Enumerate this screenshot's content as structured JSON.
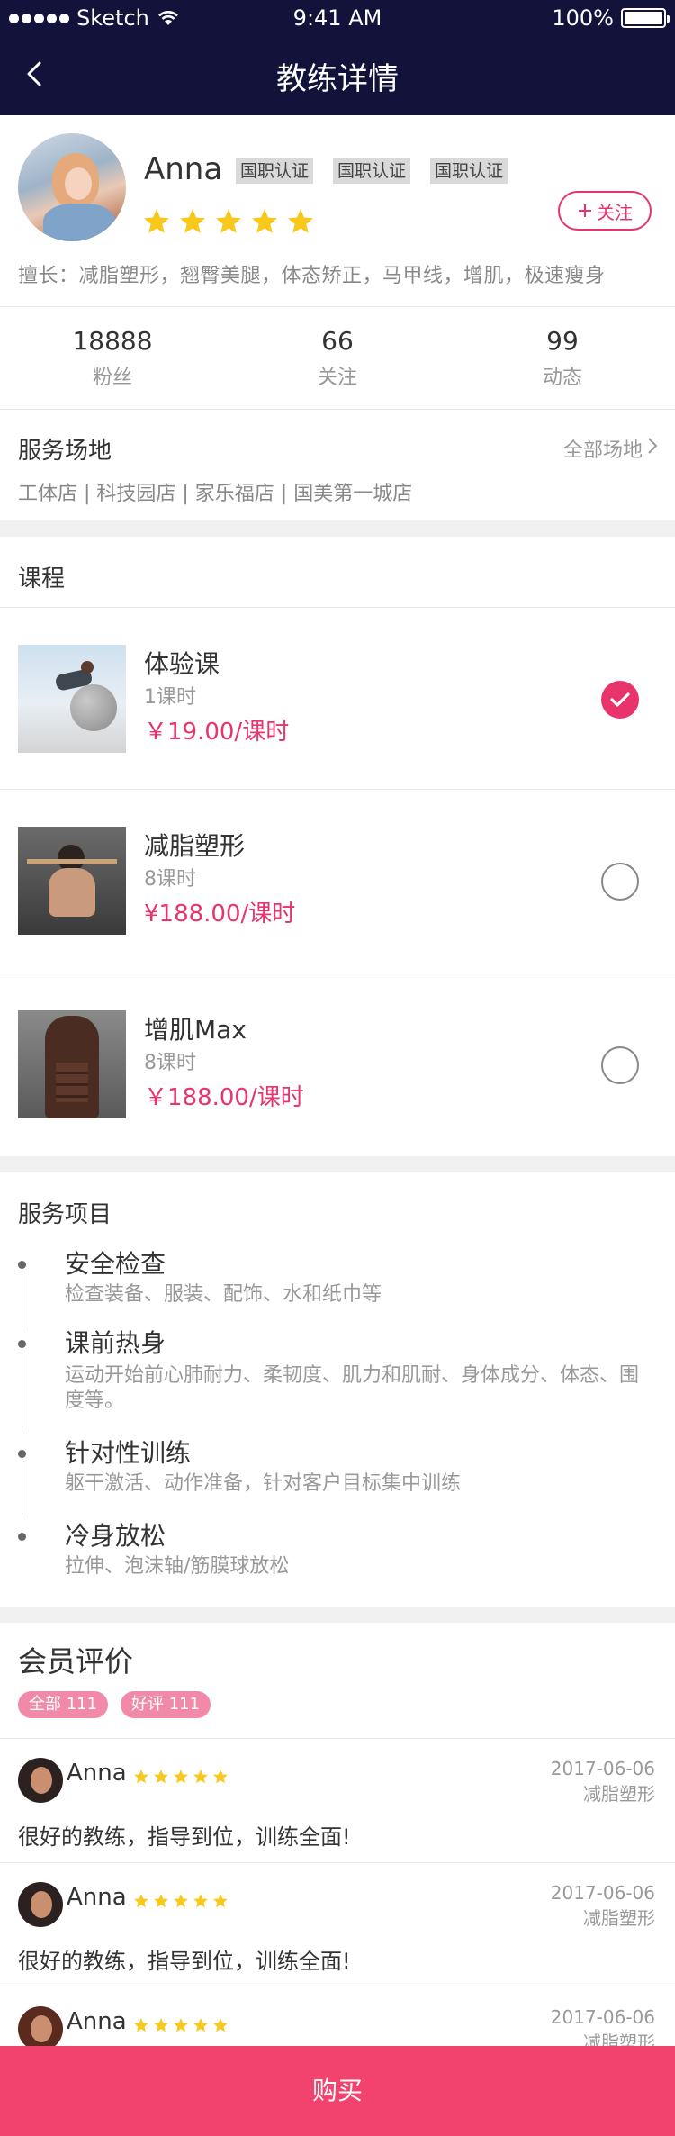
{
  "status_bar": {
    "carrier": "Sketch",
    "time": "9:41 AM",
    "battery": "100%"
  },
  "nav": {
    "title": "教练详情"
  },
  "profile": {
    "name": "Anna",
    "badges": [
      "国职认证",
      "国职认证",
      "国职认证"
    ],
    "rating": 5,
    "follow_label": "关注",
    "skills": "擅长：减脂塑形，翘臀美腿，体态矫正，马甲线，增肌，极速瘦身"
  },
  "stats": [
    {
      "num": "18888",
      "label": "粉丝"
    },
    {
      "num": "66",
      "label": "关注"
    },
    {
      "num": "99",
      "label": "动态"
    }
  ],
  "venue": {
    "title": "服务场地",
    "all_label": "全部场地",
    "list": "工体店 | 科技园店 | 家乐福店 | 国美第一城店"
  },
  "courses": {
    "title": "课程",
    "items": [
      {
        "name": "体验课",
        "hours": "1课时",
        "price": "￥19.00/课时",
        "selected": true
      },
      {
        "name": "减脂塑形",
        "hours": "8课时",
        "price": "¥188.00/课时",
        "selected": false
      },
      {
        "name": "增肌Max",
        "hours": "8课时",
        "price": "￥188.00/课时",
        "selected": false
      }
    ]
  },
  "services": {
    "title": "服务项目",
    "items": [
      {
        "title": "安全检查",
        "desc": "检查装备、服装、配饰、水和纸巾等"
      },
      {
        "title": "课前热身",
        "desc": "运动开始前心肺耐力、柔韧度、肌力和肌耐、身体成分、体态、围度等。"
      },
      {
        "title": "针对性训练",
        "desc": "躯干激活、动作准备，针对客户目标集中训练"
      },
      {
        "title": "冷身放松",
        "desc": "拉伸、泡沫轴/筋膜球放松"
      }
    ]
  },
  "reviews": {
    "title": "会员评价",
    "tags": [
      "全部 111",
      "好评 111"
    ],
    "items": [
      {
        "name": "Anna",
        "date": "2017-06-06",
        "course": "减脂塑形",
        "text": "很好的教练，指导到位，训练全面!"
      },
      {
        "name": "Anna",
        "date": "2017-06-06",
        "course": "减脂塑形",
        "text": "很好的教练，指导到位，训练全面!"
      },
      {
        "name": "Anna",
        "date": "2017-06-06",
        "course": "减脂塑形",
        "text": ""
      }
    ]
  },
  "buy": {
    "label": "购买"
  },
  "colors": {
    "nav_bg": "#12123a",
    "accent": "#e8336c",
    "star": "#f8c81c",
    "buy_bg": "#f2426e"
  }
}
